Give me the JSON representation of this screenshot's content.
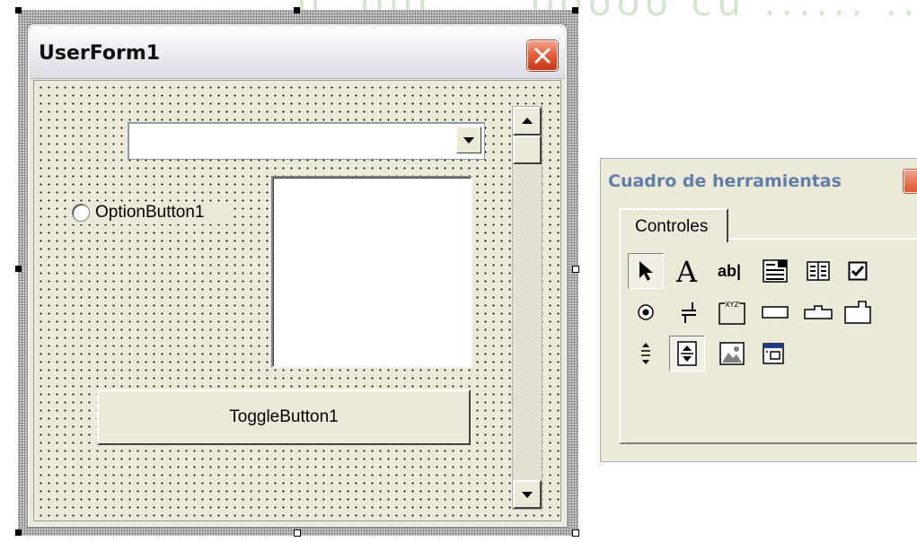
{
  "form": {
    "title": "UserForm1",
    "option_label": "OptionButton1",
    "toggle_label": "ToggleButton1"
  },
  "toolbox": {
    "title": "Cuadro de herramientas",
    "tab_label": "Controles",
    "tools": [
      "pointer-icon",
      "label-icon",
      "textbox-icon",
      "combobox-icon",
      "listbox-icon",
      "checkbox-icon",
      "optionbutton-icon",
      "togglebutton-icon",
      "frame-icon",
      "commandbutton-icon",
      "tabstrip-icon",
      "multipage-icon",
      "scrollbar-icon",
      "spinbutton-icon",
      "image-icon",
      "refedit-icon"
    ],
    "textbox_glyph": "ab|",
    "label_glyph": "A",
    "frame_glyph": "XYZ"
  },
  "colors": {
    "face": "#ece9d8",
    "close_red": "#e0522c",
    "toolbox_title": "#5e7fa8"
  }
}
